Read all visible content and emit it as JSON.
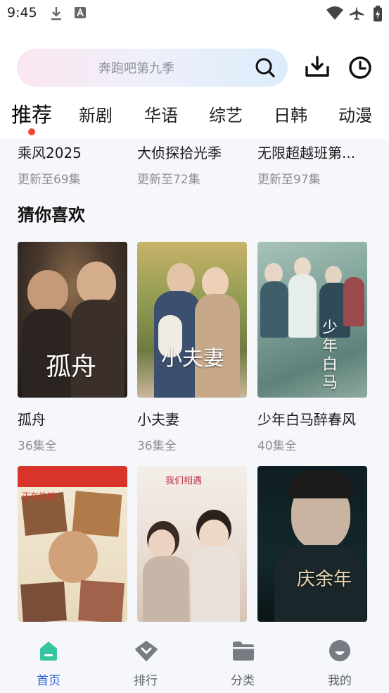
{
  "status_bar": {
    "time": "9:45",
    "icons": [
      "download-icon",
      "font-a-icon",
      "wifi-icon",
      "airplane-icon",
      "battery-icon"
    ]
  },
  "search": {
    "placeholder": "奔跑吧第九季"
  },
  "tabs": [
    {
      "label": "推荐",
      "active": true
    },
    {
      "label": "新剧",
      "active": false
    },
    {
      "label": "华语",
      "active": false
    },
    {
      "label": "综艺",
      "active": false
    },
    {
      "label": "日韩",
      "active": false
    },
    {
      "label": "动漫",
      "active": false
    }
  ],
  "prev_row": [
    {
      "title": "乘风2025",
      "sub": "更新至69集"
    },
    {
      "title": "大侦探拾光季",
      "sub": "更新至72集"
    },
    {
      "title": "无限超越班第...",
      "sub": "更新至97集"
    }
  ],
  "section": {
    "title": "猜你喜欢"
  },
  "cards": [
    {
      "title": "孤舟",
      "sub": "36集全",
      "poster_text": "孤舟"
    },
    {
      "title": "小夫妻",
      "sub": "36集全",
      "poster_text": "小夫妻"
    },
    {
      "title": "少年白马醉春风",
      "sub": "40集全",
      "poster_text": "少年白马"
    },
    {
      "title": "",
      "sub": "",
      "poster_text": "正在热映"
    },
    {
      "title": "",
      "sub": "",
      "poster_text": "我们相遇"
    },
    {
      "title": "",
      "sub": "",
      "poster_text": "庆余年"
    }
  ],
  "bottom_nav": [
    {
      "label": "首页",
      "active": true,
      "icon": "home-icon"
    },
    {
      "label": "排行",
      "active": false,
      "icon": "ranking-icon"
    },
    {
      "label": "分类",
      "active": false,
      "icon": "folder-icon"
    },
    {
      "label": "我的",
      "active": false,
      "icon": "profile-icon"
    }
  ],
  "colors": {
    "accent": "#2a5fd4",
    "dot": "#f0453a",
    "home_icon": "#36c5a0",
    "content_bg": "#f6f7fb"
  }
}
